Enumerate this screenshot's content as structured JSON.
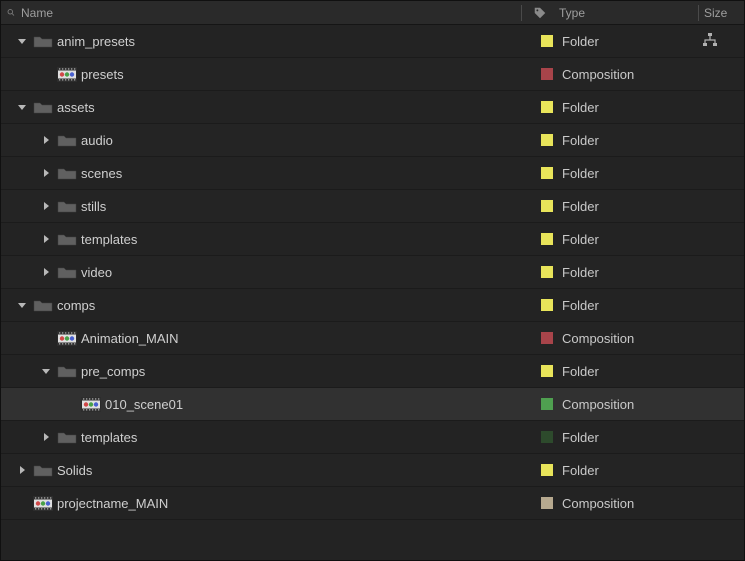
{
  "headers": {
    "name": "Name",
    "type": "Type",
    "size": "Size"
  },
  "colors": {
    "yellow": "#e8e45a",
    "darkred": "#a8444a",
    "green": "#4fa050",
    "darkgreen": "#2d4a2c",
    "tan": "#b6a98f"
  },
  "rows": [
    {
      "indent": 0,
      "twisty": "open",
      "icon": "folder",
      "name": "anim_presets",
      "color": "yellow",
      "type": "Folder",
      "flow": true
    },
    {
      "indent": 1,
      "twisty": "none",
      "icon": "comp",
      "name": "presets",
      "color": "darkred",
      "type": "Composition"
    },
    {
      "indent": 0,
      "twisty": "open",
      "icon": "folder",
      "name": "assets",
      "color": "yellow",
      "type": "Folder"
    },
    {
      "indent": 1,
      "twisty": "closed",
      "icon": "folder",
      "name": "audio",
      "color": "yellow",
      "type": "Folder"
    },
    {
      "indent": 1,
      "twisty": "closed",
      "icon": "folder",
      "name": "scenes",
      "color": "yellow",
      "type": "Folder"
    },
    {
      "indent": 1,
      "twisty": "closed",
      "icon": "folder",
      "name": "stills",
      "color": "yellow",
      "type": "Folder"
    },
    {
      "indent": 1,
      "twisty": "closed",
      "icon": "folder",
      "name": "templates",
      "color": "yellow",
      "type": "Folder"
    },
    {
      "indent": 1,
      "twisty": "closed",
      "icon": "folder",
      "name": "video",
      "color": "yellow",
      "type": "Folder"
    },
    {
      "indent": 0,
      "twisty": "open",
      "icon": "folder",
      "name": "comps",
      "color": "yellow",
      "type": "Folder"
    },
    {
      "indent": 1,
      "twisty": "none",
      "icon": "comp",
      "name": "Animation_MAIN",
      "color": "darkred",
      "type": "Composition"
    },
    {
      "indent": 1,
      "twisty": "open",
      "icon": "folder",
      "name": "pre_comps",
      "color": "yellow",
      "type": "Folder"
    },
    {
      "indent": 2,
      "twisty": "none",
      "icon": "comp",
      "name": "010_scene01",
      "color": "green",
      "type": "Composition",
      "selected": true
    },
    {
      "indent": 1,
      "twisty": "closed",
      "icon": "folder",
      "name": "templates",
      "color": "darkgreen",
      "type": "Folder"
    },
    {
      "indent": 0,
      "twisty": "closed",
      "icon": "folder",
      "name": "Solids",
      "color": "yellow",
      "type": "Folder"
    },
    {
      "indent": 0,
      "twisty": "none",
      "icon": "comp",
      "name": "projectname_MAIN",
      "color": "tan",
      "type": "Composition"
    }
  ]
}
